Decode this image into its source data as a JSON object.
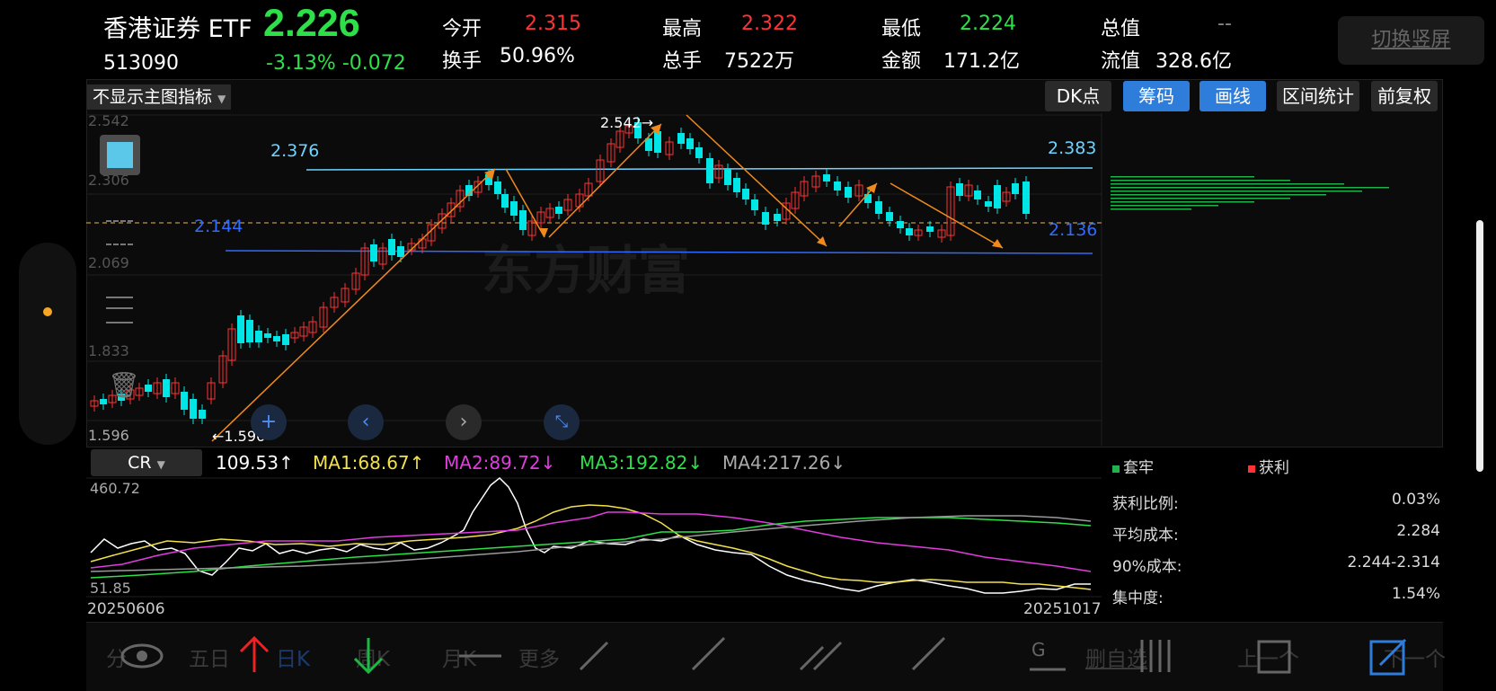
{
  "header": {
    "name": "香港证券 ETF",
    "price": "2.226",
    "code": "513090",
    "change": "-3.13% -0.072",
    "switch_label": "切换竖屏"
  },
  "stats": [
    {
      "label": "今开",
      "value": "2.315",
      "color": "#ff3333"
    },
    {
      "label": "最高",
      "value": "2.322",
      "color": "#ff3333"
    },
    {
      "label": "最低",
      "value": "2.224",
      "color": "#2de048"
    },
    {
      "label": "总值",
      "value": "--",
      "color": "#888888"
    },
    {
      "label": "换手",
      "value": "50.96%",
      "color": "#ffffff"
    },
    {
      "label": "总手",
      "value": "7522万",
      "color": "#ffffff"
    },
    {
      "label": "金额",
      "value": "171.2亿",
      "color": "#ffffff"
    },
    {
      "label": "流值",
      "value": "328.6亿",
      "color": "#ffffff"
    }
  ],
  "toolbar": {
    "main_indicator": "不显示主图指标",
    "dk": "DK点",
    "chouma": "筹码",
    "huaxian": "画线",
    "qujian": "区间统计",
    "fuquan": "前复权"
  },
  "main_chart": {
    "y_labels": [
      "2.542",
      "2.306",
      "2.069",
      "1.833",
      "1.596"
    ],
    "line_labels": {
      "top_left": "2.376",
      "top_right": "2.383",
      "bot_left": "2.144",
      "bot_right": "2.136"
    },
    "high_mark": "2.542→",
    "low_mark": "←1.596",
    "watermark": "东方财富"
  },
  "indicator": {
    "name": "CR",
    "value": "109.53",
    "ma1": "MA1:68.67",
    "ma2": "MA2:89.72",
    "ma3": "MA3:192.82",
    "ma4": "MA4:217.26",
    "y_top": "460.72",
    "y_bot": "51.85",
    "date_start": "20250606",
    "date_end": "20251017"
  },
  "chip_panel": {
    "legend_trapped": "套牢",
    "legend_profit": "获利",
    "rows": [
      {
        "label": "获利比例:",
        "value": "0.03%"
      },
      {
        "label": "平均成本:",
        "value": "2.284"
      },
      {
        "label": "90%成本:",
        "value": "2.244-2.314"
      },
      {
        "label": "集中度:",
        "value": "1.54%"
      }
    ]
  },
  "bottom": {
    "fen": "分",
    "five_day": "五日",
    "day_k": "日K",
    "week_k": "周K",
    "month_k": "月K",
    "more": "更多",
    "delete_sel": "删自选",
    "prev": "上一个",
    "next": "下一个"
  },
  "colors": {
    "up": "#ff3333",
    "down": "#00e5e5",
    "accent": "#2e7ddb",
    "green": "#2de048"
  }
}
